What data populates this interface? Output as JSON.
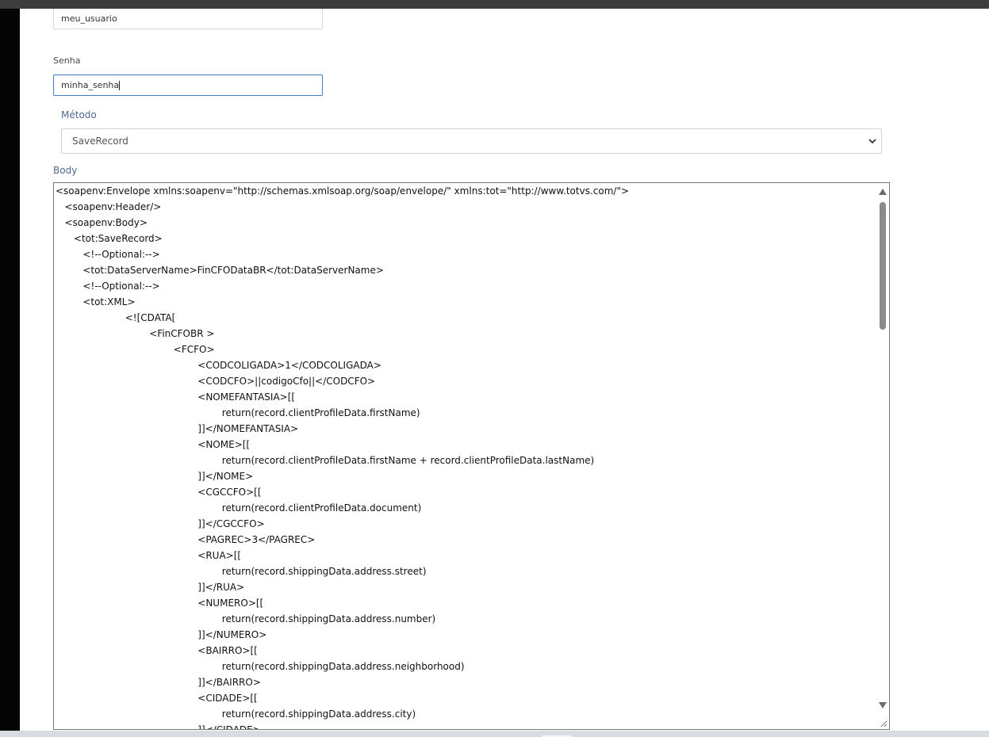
{
  "form": {
    "username_value": "meu_usuario",
    "password_label": "Senha",
    "password_value": "minha_senha",
    "method_label": "Método",
    "method_selected": "SaveRecord",
    "body_label": "Body"
  },
  "body_code": [
    "<soapenv:Envelope xmlns:soapenv=\"http://schemas.xmlsoap.org/soap/envelope/\" xmlns:tot=\"http://www.totvs.com/\">",
    "   <soapenv:Header/>",
    "   <soapenv:Body>",
    "      <tot:SaveRecord>",
    "         <!--Optional:-->",
    "         <tot:DataServerName>FinCFODataBR</tot:DataServerName>",
    "         <!--Optional:-->",
    "         <tot:XML>",
    "                       <![CDATA[",
    "                               <FinCFOBR >",
    "                                       <FCFO>",
    "                                               <CODCOLIGADA>1</CODCOLIGADA>",
    "                                               <CODCFO>||codigoCfo||</CODCFO>",
    "                                               <NOMEFANTASIA>[[",
    "                                                       return(record.clientProfileData.firstName)",
    "                                               ]]</NOMEFANTASIA>",
    "                                               <NOME>[[",
    "                                                       return(record.clientProfileData.firstName + record.clientProfileData.lastName)",
    "                                               ]]</NOME>",
    "                                               <CGCCFO>[[",
    "                                                       return(record.clientProfileData.document)",
    "                                               ]]</CGCCFO>",
    "                                               <PAGREC>3</PAGREC>",
    "                                               <RUA>[[",
    "                                                       return(record.shippingData.address.street)",
    "                                               ]]</RUA>",
    "                                               <NUMERO>[[",
    "                                                       return(record.shippingData.address.number)",
    "                                               ]]</NUMERO>",
    "                                               <BAIRRO>[[",
    "                                                       return(record.shippingData.address.neighborhood)",
    "                                               ]]</BAIRRO>",
    "                                               <CIDADE>[[",
    "                                                       return(record.shippingData.address.city)",
    "                                               ]]</CIDADE>"
  ]
}
